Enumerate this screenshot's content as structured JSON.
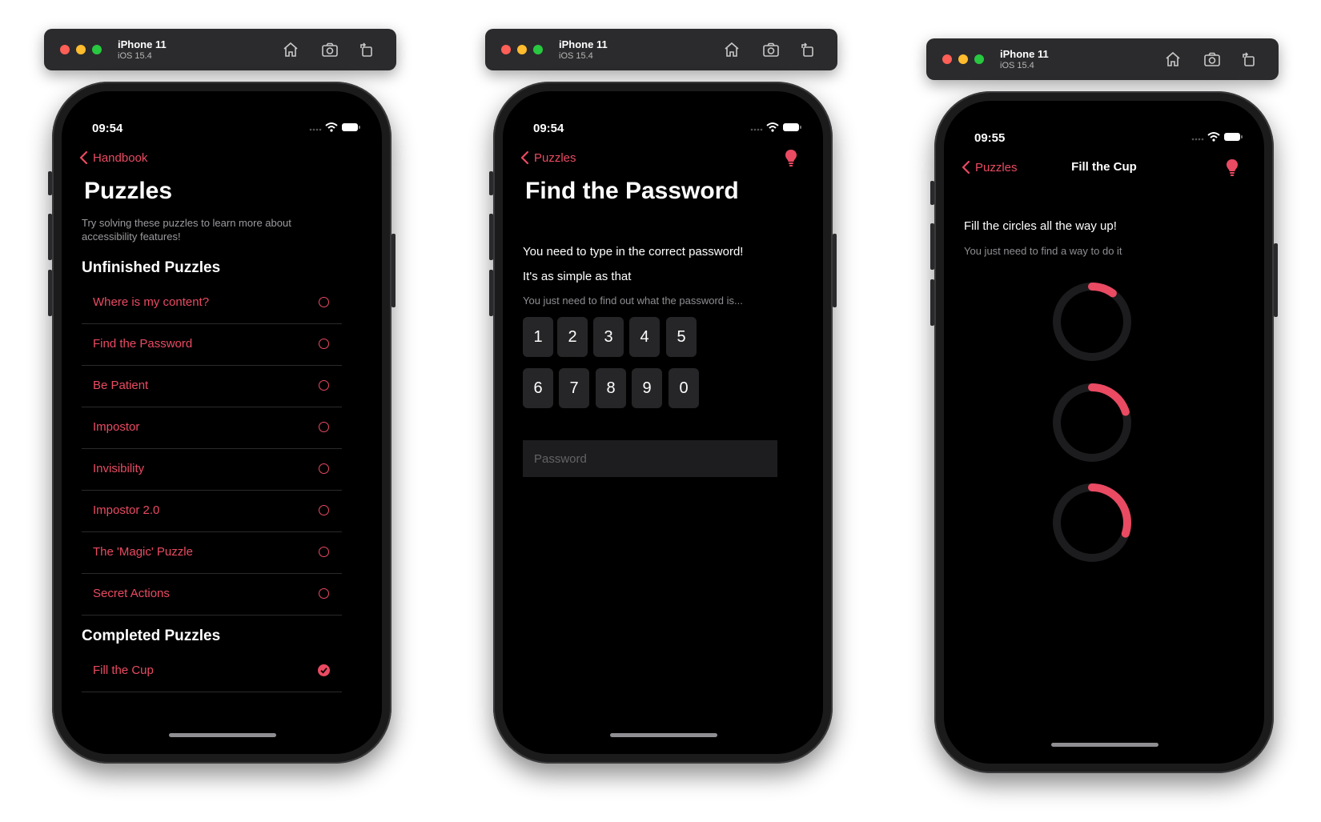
{
  "simulator": {
    "device_name": "iPhone 11",
    "os": "iOS 15.4",
    "traffic_lights": [
      "#fe5f57",
      "#febc2e",
      "#28c840"
    ],
    "toolbar_icons": [
      "home-icon",
      "screenshot-icon",
      "rotate-icon"
    ]
  },
  "theme": {
    "accent": "#ea4a62",
    "background": "#000000"
  },
  "screens": {
    "puzzles": {
      "time": "09:54",
      "back_label": "Handbook",
      "title": "Puzzles",
      "subtitle": "Try solving these puzzles to learn more about accessibility features!",
      "unfinished_title": "Unfinished Puzzles",
      "unfinished": [
        "Where is my content?",
        "Find the Password",
        "Be Patient",
        "Impostor",
        "Invisibility",
        "Impostor 2.0",
        "The 'Magic' Puzzle",
        "Secret Actions"
      ],
      "completed_title": "Completed Puzzles",
      "completed": [
        "Fill the Cup"
      ]
    },
    "password": {
      "time": "09:54",
      "back_label": "Puzzles",
      "title": "Find the Password",
      "line1": "You need to type in the correct password!",
      "line2": "It's as simple as that",
      "hint": "You just need to find out what the password is...",
      "keys_row1": [
        "1",
        "2",
        "3",
        "4",
        "5"
      ],
      "keys_row2": [
        "6",
        "7",
        "8",
        "9",
        "0"
      ],
      "password_placeholder": "Password"
    },
    "cup": {
      "time": "09:55",
      "back_label": "Puzzles",
      "nav_title": "Fill the Cup",
      "line1": "Fill the circles all the way up!",
      "hint": "You just need to find a way to do it",
      "circle_fill_fractions": [
        0.1,
        0.2,
        0.3
      ]
    }
  }
}
